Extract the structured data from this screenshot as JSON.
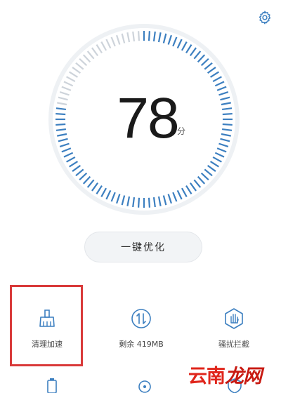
{
  "header": {
    "settings_icon": "gear-icon"
  },
  "gauge": {
    "score": "78",
    "unit": "分",
    "fill_fraction": 0.78
  },
  "primary_action": {
    "label": "一键优化"
  },
  "tools": [
    {
      "label": "清理加速",
      "icon": "broom-icon"
    },
    {
      "label": "剩余 419MB",
      "icon": "memory-swap-icon"
    },
    {
      "label": "骚扰拦截",
      "icon": "hand-shield-icon"
    }
  ],
  "bottom_row_icons": [
    "battery-icon",
    "circle-icon",
    "shield-icon"
  ],
  "watermark": {
    "text": "云南",
    "text_tail": "龙网"
  },
  "colors": {
    "accent": "#3c7fc0",
    "track": "#cdd3da",
    "highlight": "#d93a3a",
    "watermark": "#e0251b"
  }
}
